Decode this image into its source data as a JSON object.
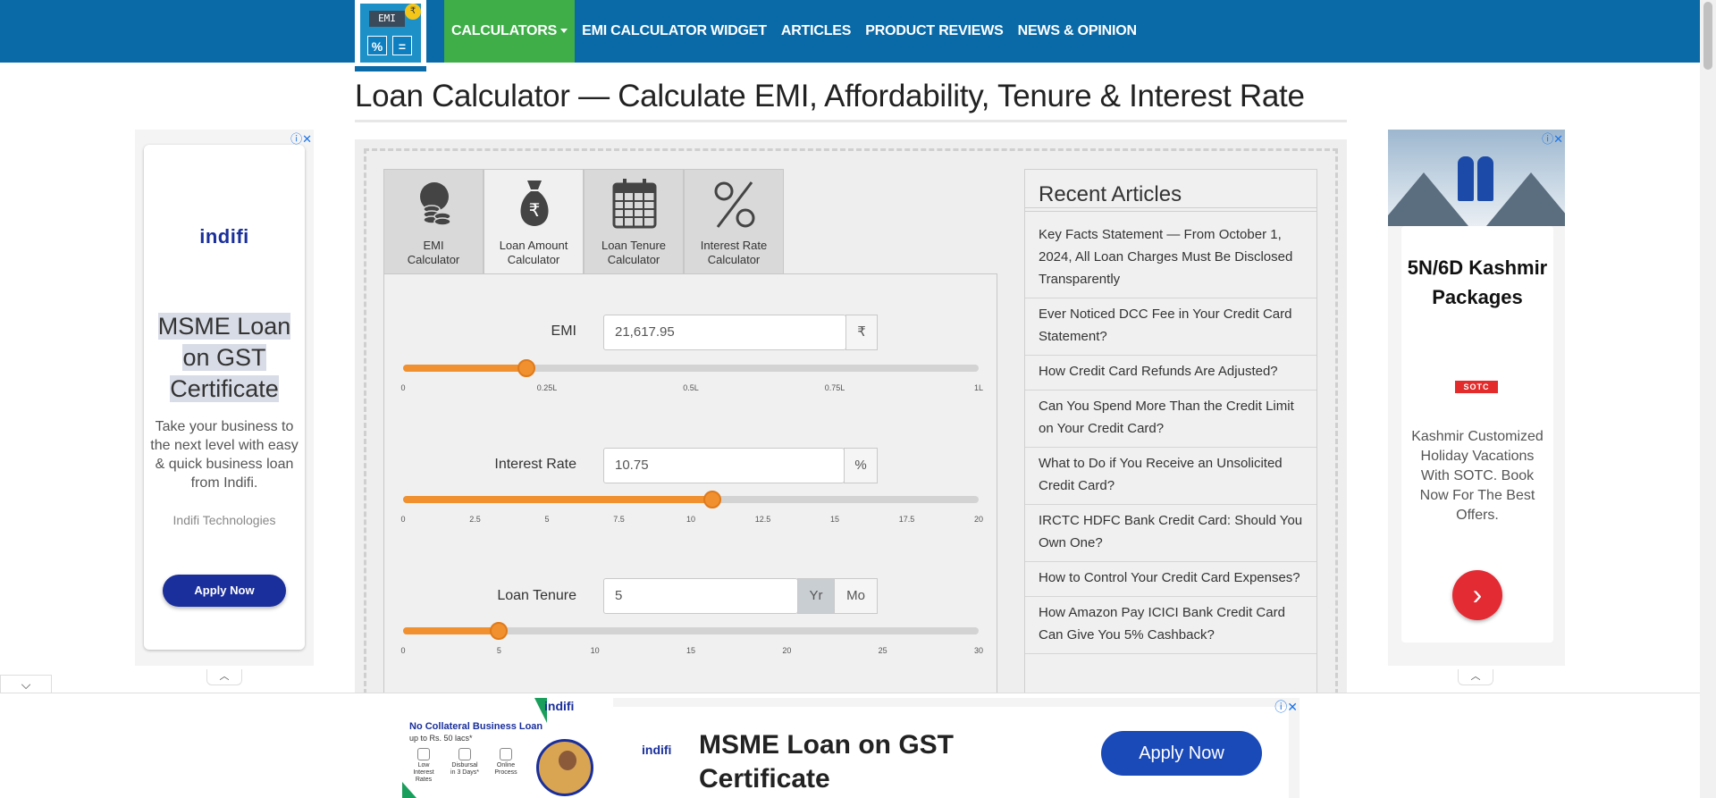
{
  "logo": {
    "screen_text": "EMI",
    "coin": "₹",
    "key1": "%",
    "key2": "="
  },
  "nav": {
    "items": [
      {
        "label": "CALCULATORS"
      },
      {
        "label": "EMI CALCULATOR WIDGET"
      },
      {
        "label": "ARTICLES"
      },
      {
        "label": "PRODUCT REVIEWS"
      },
      {
        "label": "NEWS & OPINION"
      }
    ]
  },
  "page_title": "Loan Calculator — Calculate EMI, Affordability, Tenure & Interest Rate",
  "tabs": [
    {
      "line1": "EMI",
      "line2": "Calculator",
      "icon": "coins-icon"
    },
    {
      "line1": "Loan Amount",
      "line2": "Calculator",
      "icon": "money-bag-icon"
    },
    {
      "line1": "Loan Tenure",
      "line2": "Calculator",
      "icon": "calendar-icon"
    },
    {
      "line1": "Interest Rate",
      "line2": "Calculator",
      "icon": "percent-icon"
    }
  ],
  "calculator": {
    "emi": {
      "label": "EMI",
      "value": "21,617.95",
      "addon": "₹",
      "slider_fraction": 0.215,
      "ticks": [
        "0",
        "0.25L",
        "0.5L",
        "0.75L",
        "1L"
      ]
    },
    "interest": {
      "label": "Interest Rate",
      "value": "10.75",
      "addon": "%",
      "slider_fraction": 0.5375,
      "ticks": [
        "0",
        "2.5",
        "5",
        "7.5",
        "10",
        "12.5",
        "15",
        "17.5",
        "20"
      ]
    },
    "tenure": {
      "label": "Loan Tenure",
      "value": "5",
      "addon_year": "Yr",
      "addon_month": "Mo",
      "slider_fraction": 0.1667,
      "ticks": [
        "0",
        "5",
        "10",
        "15",
        "20",
        "25",
        "30"
      ]
    }
  },
  "recent": {
    "title": "Recent Articles",
    "articles": [
      "Key Facts Statement — From October 1, 2024, All Loan Charges Must Be Disclosed Transparently",
      "Ever Noticed DCC Fee in Your Credit Card Statement?",
      "How Credit Card Refunds Are Adjusted?",
      "Can You Spend More Than the Credit Limit on Your Credit Card?",
      "What to Do if You Receive an Unsolicited Credit Card?",
      "IRCTC HDFC Bank Credit Card: Should You Own One?",
      "How to Control Your Credit Card Expenses?",
      "How Amazon Pay ICICI Bank Credit Card Can Give You 5% Cashback?"
    ]
  },
  "ad_left": {
    "brand": "indifi",
    "headline": "MSME Loan on GST Certificate",
    "body": "Take your business to the next level with easy & quick business loan from Indifi.",
    "company": "Indifi Technologies",
    "button": "Apply Now"
  },
  "ad_right": {
    "headline": "5N/6D Kashmir Packages",
    "logo": "SOTC",
    "body": "Kashmir Customized Holiday Vacations With SOTC. Book Now For The Best Offers.",
    "button": "›"
  },
  "ad_bottom": {
    "brand_small": "indifi",
    "tagline": "No Collateral Business Loan",
    "sub": "up to Rs. 50 lacs*",
    "features": [
      "Low Interest Rates",
      "Disbursal in 3 Days*",
      "Online Process"
    ],
    "brand": "indifi",
    "headline": "MSME Loan on GST Certificate",
    "button": "Apply Now"
  },
  "adchoices": "ⓘ✕",
  "ui": {
    "collapse_down": "⌵",
    "collapse_up": "︿"
  },
  "colors": {
    "nav": "#0a6aa8",
    "nav_active": "#3fae49",
    "slider": "#f0902f",
    "indifi_blue": "#1a2f9c",
    "sotc_red": "#e32b34"
  }
}
